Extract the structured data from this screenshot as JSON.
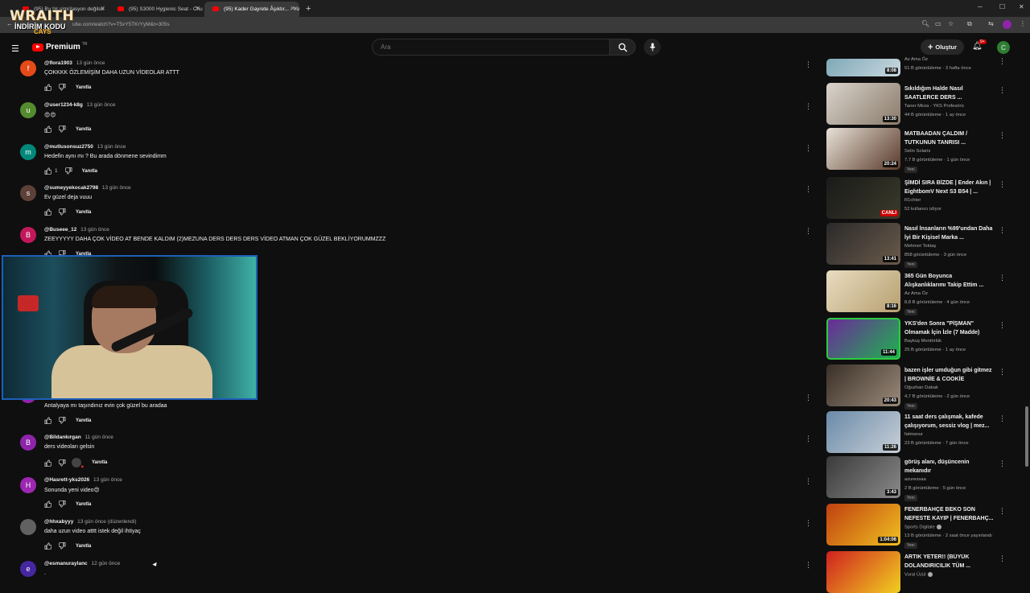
{
  "browser": {
    "tabs": [
      {
        "title": "(95) Bu bir simülasyon değilse",
        "close": "✕"
      },
      {
        "title": "(95) S3000 Hygienic Seat - Chu",
        "close": "✕"
      },
      {
        "title": "(95) Kader Gayrete Âşıktır... - Yo",
        "close": "✕"
      }
    ],
    "new_tab": "+",
    "url": "ube.com/watch?v=T5xY5TKrYyM&t=305s"
  },
  "overlay": {
    "brand": "WRAITH",
    "promo": "İNDİRİM KODU",
    "code": "CAYS"
  },
  "header": {
    "logo_text": "Premium",
    "region": "TR",
    "search_placeholder": "Ara",
    "create_label": "Oluştur",
    "notif_count": "9+",
    "avatar_letter": "C"
  },
  "comments": [
    {
      "avatar": "f",
      "color": "#e64a19",
      "handle": "@flora1903",
      "time": "13 gün önce",
      "text": "ÇOKKKK ÖZLEMİŞİM DAHA UZUN VİDEOLAR ATTT",
      "likes": "",
      "reply": "Yanıtla"
    },
    {
      "avatar": "u",
      "color": "#558b2f",
      "handle": "@user1234-k8g",
      "time": "13 gün önce",
      "text": "😍😍",
      "likes": "",
      "reply": "Yanıtla"
    },
    {
      "avatar": "m",
      "color": "#00897b",
      "handle": "@mutlusonsuz2750",
      "time": "13 gün önce",
      "text": "Hedefin aynı mı ? Bu arada dönmene sevindimm",
      "likes": "1",
      "reply": "Yanıtla"
    },
    {
      "avatar": "s",
      "color": "#5d4037",
      "handle": "@sumeyyekocak2798",
      "time": "13 gün önce",
      "text": "Ev güzel deja vuuu",
      "likes": "",
      "reply": "Yanıtla"
    },
    {
      "avatar": "B",
      "color": "#c2185b",
      "handle": "@Buseee_12",
      "time": "13 gün önce",
      "text": "ZEEYYYYY DAHA ÇOK VİDEO AT BENDE KALDIM (2)MEZUNA DERS DERS DERS  VİDEO ATMAN ÇOK GÜZEL BEKLİYORUMMZZZ",
      "likes": "",
      "reply": "Yanıtla"
    },
    {
      "avatar": "",
      "color": "#c2185b",
      "handle": "",
      "time": "",
      "text": "",
      "likes": "",
      "reply": ""
    },
    {
      "avatar": "",
      "color": "#7b1fa2",
      "handle": "",
      "time": "",
      "text": "",
      "likes": "",
      "reply": ""
    },
    {
      "avatar": "",
      "color": "#7b1fa2",
      "handle": "",
      "time": "",
      "text": "",
      "likes": "",
      "reply": ""
    },
    {
      "avatar": "ə",
      "color": "#8e24aa",
      "handle": "",
      "time": "",
      "text": "Antalyaya mı taşındınız evin çok güzel bu aradaa",
      "likes": "",
      "reply": "Yanıtla"
    },
    {
      "avatar": "B",
      "color": "#8e24aa",
      "handle": "@Bildankırgan",
      "time": "11 gün önce",
      "text": "ders videoları gelsin",
      "likes": "",
      "reply": "Yanıtla",
      "hearted": true
    },
    {
      "avatar": "H",
      "color": "#9c27b0",
      "handle": "@Hasrett-yks2026",
      "time": "13 gün önce",
      "text": "Sonunda yeni video😍",
      "likes": "",
      "reply": "Yanıtla"
    },
    {
      "avatar": "",
      "color": "#616161",
      "handle": "@hhxabyyy",
      "time": "13 gün önce (düzenlendi)",
      "text": "daha uzun video atttt istek değil ihtiyaç",
      "likes": "",
      "reply": "Yanıtla"
    },
    {
      "avatar": "e",
      "color": "#4527a0",
      "handle": "@esmanuraylanc",
      "time": "12 gün önce",
      "text": ".",
      "likes": "",
      "reply": ""
    }
  ],
  "sidebar": [
    {
      "title": "",
      "channel": "Az Ama Öz",
      "meta": "51 B görüntüleme · 3 hafta önce",
      "duration": "8:08",
      "new": "",
      "thumb": [
        "#7fa8b8",
        "#c9d8de"
      ]
    },
    {
      "title": "Sıkıldığım Halde Nasıl SAATLERCE DERS ...",
      "channel": "Taner Mirza - YKS Profesörü",
      "meta": "44 B görüntüleme · 1 ay önce",
      "duration": "13:30",
      "new": "",
      "thumb": [
        "#d9d4cc",
        "#8a7a6a"
      ]
    },
    {
      "title": "MATBAADAN ÇALDIM / TUTKUNUN TANRISI ...",
      "channel": "Selin Solaris",
      "meta": "7,7 B görüntüleme · 1 gün önce",
      "duration": "20:24",
      "new": "Yeni",
      "thumb": [
        "#e8e2d8",
        "#5a3a2a"
      ]
    },
    {
      "title": "ŞİMDİ SIRA BİZDE | Ender Akın | EightbomV Next S3 B54 | ...",
      "channel": "R1chter",
      "meta": "52 kullanıcı izliyor",
      "duration": "CANLI",
      "new": "",
      "thumb": [
        "#1a1a1a",
        "#3a3a2a"
      ],
      "live": true
    },
    {
      "title": "Nasıl İnsanların %99'undan Daha İyi Bir Kişisel Marka ...",
      "channel": "Mehmet Toktaş",
      "meta": "858 görüntüleme · 3 gün önce",
      "duration": "13:41",
      "new": "Yeni",
      "thumb": [
        "#2a2a2a",
        "#6a5a4a"
      ]
    },
    {
      "title": "365 Gün Boyunca Alışkanlıklarımı Takip Ettim ...",
      "channel": "Az Ama Öz",
      "meta": "8,8 B görüntüleme · 4 gün önce",
      "duration": "8:16",
      "new": "Yeni",
      "thumb": [
        "#e8dcc0",
        "#b8a070"
      ]
    },
    {
      "title": "YKS'den Sonra \"PİŞMAN\" Olmamak İçin İzle (7 Madde)",
      "channel": "Baykuş Mentörlük",
      "meta": "25 B görüntüleme · 1 ay önce",
      "duration": "11:44",
      "new": "",
      "thumb": [
        "#6a2a9a",
        "#20b050"
      ]
    },
    {
      "title": "bazen işler umduğun gibi gitmez | BROWNİE & COOKİE",
      "channel": "Oğuzhan Dabak",
      "meta": "4,7 B görüntüleme · 2 gün önce",
      "duration": "20:43",
      "new": "Yeni",
      "thumb": [
        "#3a3028",
        "#9a8a7a"
      ]
    },
    {
      "title": "11 saat ders çalışmak, kafede çalışıyorum, sessiz vlog | mez...",
      "channel": "fatmanur",
      "meta": "23 B görüntüleme · 7 gün önce",
      "duration": "11:26",
      "new": "",
      "thumb": [
        "#6a8aa8",
        "#c8d0d8"
      ]
    },
    {
      "title": "görüş alanı, düşüncenin mekanıdır",
      "channel": "azuressaa",
      "meta": "2 B görüntüleme · 5 gün önce",
      "duration": "3:43",
      "new": "Yeni",
      "thumb": [
        "#3a3a3a",
        "#8a8a8a"
      ]
    },
    {
      "title": "FENERBAHÇE BEKO SON NEFESTE KAYIP | FENERBAHÇ...",
      "channel": "Sports Digitale",
      "meta": "13 B görüntüleme · 2 saat önce yayınlandı",
      "duration": "1:04:06",
      "new": "Yeni",
      "thumb": [
        "#c04010",
        "#f0c020"
      ],
      "verified": true
    },
    {
      "title": "ARTIK YETER!! (BÜYÜK DOLANDIRICILIK TÜM ...",
      "channel": "Vural Üzül",
      "meta": "",
      "duration": "",
      "new": "",
      "thumb": [
        "#d02020",
        "#f0d020"
      ],
      "verified": true
    }
  ]
}
